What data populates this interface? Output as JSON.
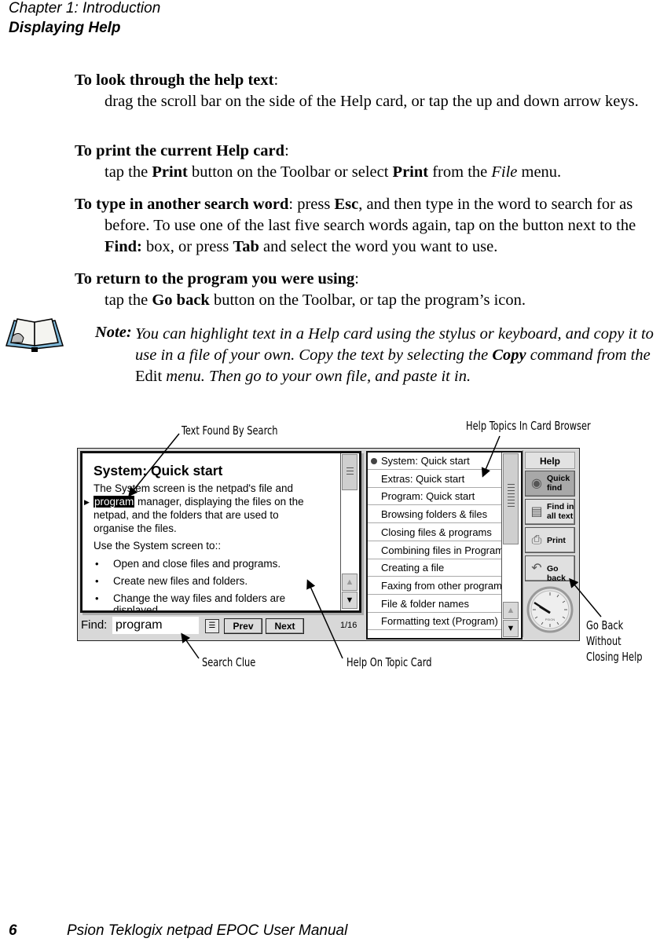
{
  "header": {
    "chapter": "Chapter 1:  Introduction",
    "section": "Displaying Help"
  },
  "instructions": [
    {
      "heading": "To look through the help text",
      "text": "drag the scroll bar on the side of the Help card, or tap the up and down arrow keys."
    },
    {
      "heading": "To print the current Help card",
      "text_parts": [
        "tap the ",
        "Print",
        " button on the Toolbar or select ",
        "Print",
        " from the ",
        "File",
        " menu."
      ]
    },
    {
      "heading": "To type in another search word",
      "text_parts": [
        ": press ",
        "Esc",
        ", and then type in the word to search for as before. To use one of the last five search words again, tap on the button next to the ",
        "Find:",
        " box, or press ",
        "Tab",
        " and select the word you want to use."
      ]
    },
    {
      "heading": "To return to the program you were using",
      "text_parts": [
        "tap the ",
        "Go back",
        " button on the Toolbar, or tap the program’s icon."
      ]
    }
  ],
  "note": {
    "icon": "open-book-icon",
    "label": "Note:",
    "text_parts": [
      "You can highlight text in a Help card using the stylus or keyboard, and copy it to use in a file of your own. Copy the text by selecting the ",
      "Copy",
      " command from the ",
      "Edit",
      " menu. Then go to your own file, and paste it in."
    ]
  },
  "screenshot": {
    "card": {
      "title": "System: Quick start",
      "lines": [
        "The System screen is the  netpad's file and",
        "program",
        " manager, displaying the files on the",
        "netpad,  and the folders that are used to",
        "organise the files.",
        "Use the System screen to::"
      ],
      "bullets": [
        "Open and close files and programs.",
        "Create new files and folders.",
        "Change the way files and folders are",
        "displayed"
      ]
    },
    "find": {
      "label": "Find:",
      "value": "program",
      "prev_label": "Prev",
      "next_label": "Next",
      "page_count": "1/16"
    },
    "topics": [
      "System: Quick start",
      "Extras: Quick start",
      "Program: Quick start",
      "Browsing folders & files",
      "Closing files & programs",
      "Combining files in Programs",
      "Creating a file",
      "Faxing from other programs",
      "File & folder names",
      "Formatting text (Program)"
    ],
    "selected_topic": 0,
    "toolbar": {
      "title": "Help",
      "buttons": [
        {
          "label": "Quick find",
          "icon": "binoculars-icon",
          "active": true
        },
        {
          "label": "Find in all text",
          "icon": "find-text-icon",
          "active": false
        },
        {
          "label": "Print",
          "icon": "printer-icon",
          "active": false
        },
        {
          "label": "Go back",
          "icon": "go-back-arrow-icon",
          "active": false
        }
      ],
      "clock_brand": "PSION"
    }
  },
  "callouts": {
    "text_found": "Text Found By Search",
    "help_topics": "Help Topics In Card Browser",
    "search_clue": "Search Clue",
    "help_on_topic": "Help On Topic Card",
    "go_back": [
      "Go Back",
      "Without",
      "Closing Help"
    ]
  },
  "footer": {
    "page_number": "6",
    "title": "Psion Teklogix netpad EPOC User Manual"
  }
}
